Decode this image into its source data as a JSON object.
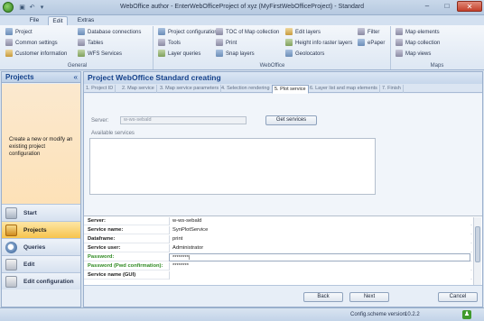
{
  "window": {
    "title": "WebOffice author - EnterWebOfficeProject of xyz (MyFirstWebOfficeProject) - Standard",
    "minimize": "–",
    "maximize": "□",
    "close": "✕"
  },
  "menu": {
    "file": "File",
    "edit": "Edit",
    "extras": "Extras"
  },
  "ribbon": {
    "general": {
      "label": "General",
      "items": [
        "Project",
        "Common settings",
        "Customer information",
        "Database connections",
        "Tables",
        "WFS Services"
      ]
    },
    "weboffice": {
      "label": "WebOffice",
      "items": [
        "Project configuration",
        "Tools",
        "Layer queries",
        "TOC of Map collection",
        "Print",
        "Snap layers",
        "Edit layers",
        "Height info raster layers",
        "Geolocators",
        "Filter",
        "ePaper"
      ]
    },
    "maps": {
      "label": "Maps",
      "items": [
        "Map elements",
        "Map collection",
        "Map views"
      ]
    }
  },
  "left_pane": {
    "title": "Projects",
    "collapse": "«",
    "description": "Create a new or modify an existing project configuration",
    "nav": [
      "Start",
      "Projects",
      "Queries",
      "Edit",
      "Edit configuration"
    ]
  },
  "main": {
    "title": "Project WebOffice Standard creating",
    "tabs": [
      "1. Project ID",
      "2. Map service",
      "3. Map service parameters",
      "4. Selection rendering",
      "5. Plot service",
      "6. Layer list and map elements",
      "7. Finish"
    ],
    "server_label": "Server:",
    "server_value": "w-ws-sebald",
    "get_services": "Get services",
    "available_services": "Available services",
    "grid": [
      {
        "key": "Server:",
        "value": "w-ws-sebald"
      },
      {
        "key": "Service name:",
        "value": "SynPlotService"
      },
      {
        "key": "Dataframe:",
        "value": "print"
      },
      {
        "key": "Service user:",
        "value": "Administrator"
      },
      {
        "key": "Password:",
        "value": "********|"
      },
      {
        "key": "Password (Pwd confirmation):",
        "value": "********"
      },
      {
        "key": "Service name (GUI)",
        "value": ""
      }
    ],
    "buttons": {
      "back": "Back",
      "next": "Next",
      "cancel": "Cancel"
    }
  },
  "status": {
    "label": "Config.scheme version:",
    "version": "10.2.2"
  }
}
